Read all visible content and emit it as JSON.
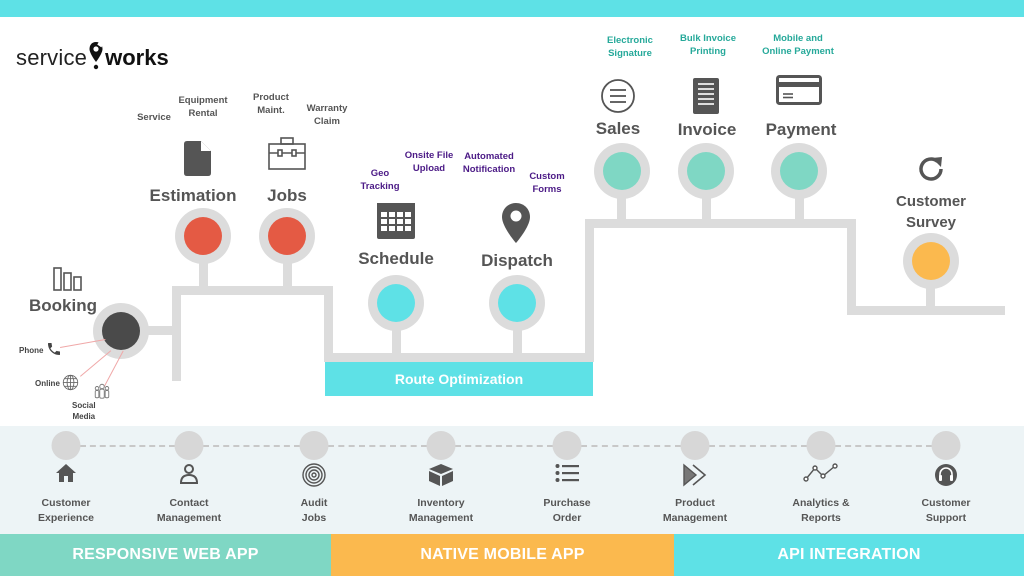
{
  "brand": {
    "name_light": "service",
    "name_bold": "works"
  },
  "colors": {
    "topbar": "#5ee1e6",
    "track": "#dcdcdc",
    "booking": "#4a4a4a",
    "estimation_jobs": "#e45a44",
    "schedule_dispatch": "#5ee1e6",
    "sales_group": "#7fd7c4",
    "survey": "#fbb94e",
    "web_app": "#7fd7c4",
    "mobile_app": "#fbb94e",
    "api": "#5ee1e6",
    "purple_text": "#4b1a86",
    "teal_text": "#26a99a"
  },
  "stages": {
    "booking": {
      "label": "Booking",
      "icon": "bar-chart-icon"
    },
    "estimation": {
      "label": "Estimation",
      "icon": "document-icon"
    },
    "jobs": {
      "label": "Jobs",
      "icon": "briefcase-icon"
    },
    "schedule": {
      "label": "Schedule",
      "icon": "calendar-icon"
    },
    "dispatch": {
      "label": "Dispatch",
      "icon": "map-pin-icon"
    },
    "sales": {
      "label": "Sales",
      "icon": "list-circle-icon"
    },
    "invoice": {
      "label": "Invoice",
      "icon": "receipt-icon"
    },
    "payment": {
      "label": "Payment",
      "icon": "credit-card-icon"
    },
    "survey": {
      "label": "Customer\nSurvey",
      "label_line1": "Customer",
      "label_line2": "Survey",
      "icon": "refresh-icon"
    }
  },
  "booking_channels": [
    {
      "label": "Phone",
      "icon": "phone-icon"
    },
    {
      "label": "Online",
      "icon": "globe-icon"
    },
    {
      "label": "Social\nMedia",
      "icon": "people-icon"
    }
  ],
  "estimation_jobs_features": [
    {
      "label": "Service"
    },
    {
      "label": "Equipment\nRental"
    },
    {
      "label": "Product\nMaint."
    },
    {
      "label": "Warranty\nClaim"
    }
  ],
  "schedule_dispatch_features": [
    {
      "label": "Geo\nTracking"
    },
    {
      "label": "Onsite File\nUpload"
    },
    {
      "label": "Automated\nNotification"
    },
    {
      "label": "Custom\nForms"
    }
  ],
  "sales_features": [
    {
      "label": "Electronic\nSignature"
    },
    {
      "label": "Bulk Invoice\nPrinting"
    },
    {
      "label": "Mobile and\nOnline Payment"
    }
  ],
  "route_optimization": {
    "label": "Route Optimization"
  },
  "platform_features": [
    {
      "label": "Customer\nExperience",
      "icon": "home-icon"
    },
    {
      "label": "Contact\nManagement",
      "icon": "user-icon"
    },
    {
      "label": "Audit\nJobs",
      "icon": "target-icon"
    },
    {
      "label": "Inventory\nManagement",
      "icon": "box-icon"
    },
    {
      "label": "Purchase\nOrder",
      "icon": "list-icon"
    },
    {
      "label": "Product\nManagement",
      "icon": "fast-forward-icon"
    },
    {
      "label": "Analytics &\nReports",
      "icon": "line-graph-icon"
    },
    {
      "label": "Customer\nSupport",
      "icon": "headset-icon"
    }
  ],
  "bands": [
    {
      "label": "RESPONSIVE WEB APP"
    },
    {
      "label": "NATIVE MOBILE APP"
    },
    {
      "label": "API INTEGRATION"
    }
  ]
}
